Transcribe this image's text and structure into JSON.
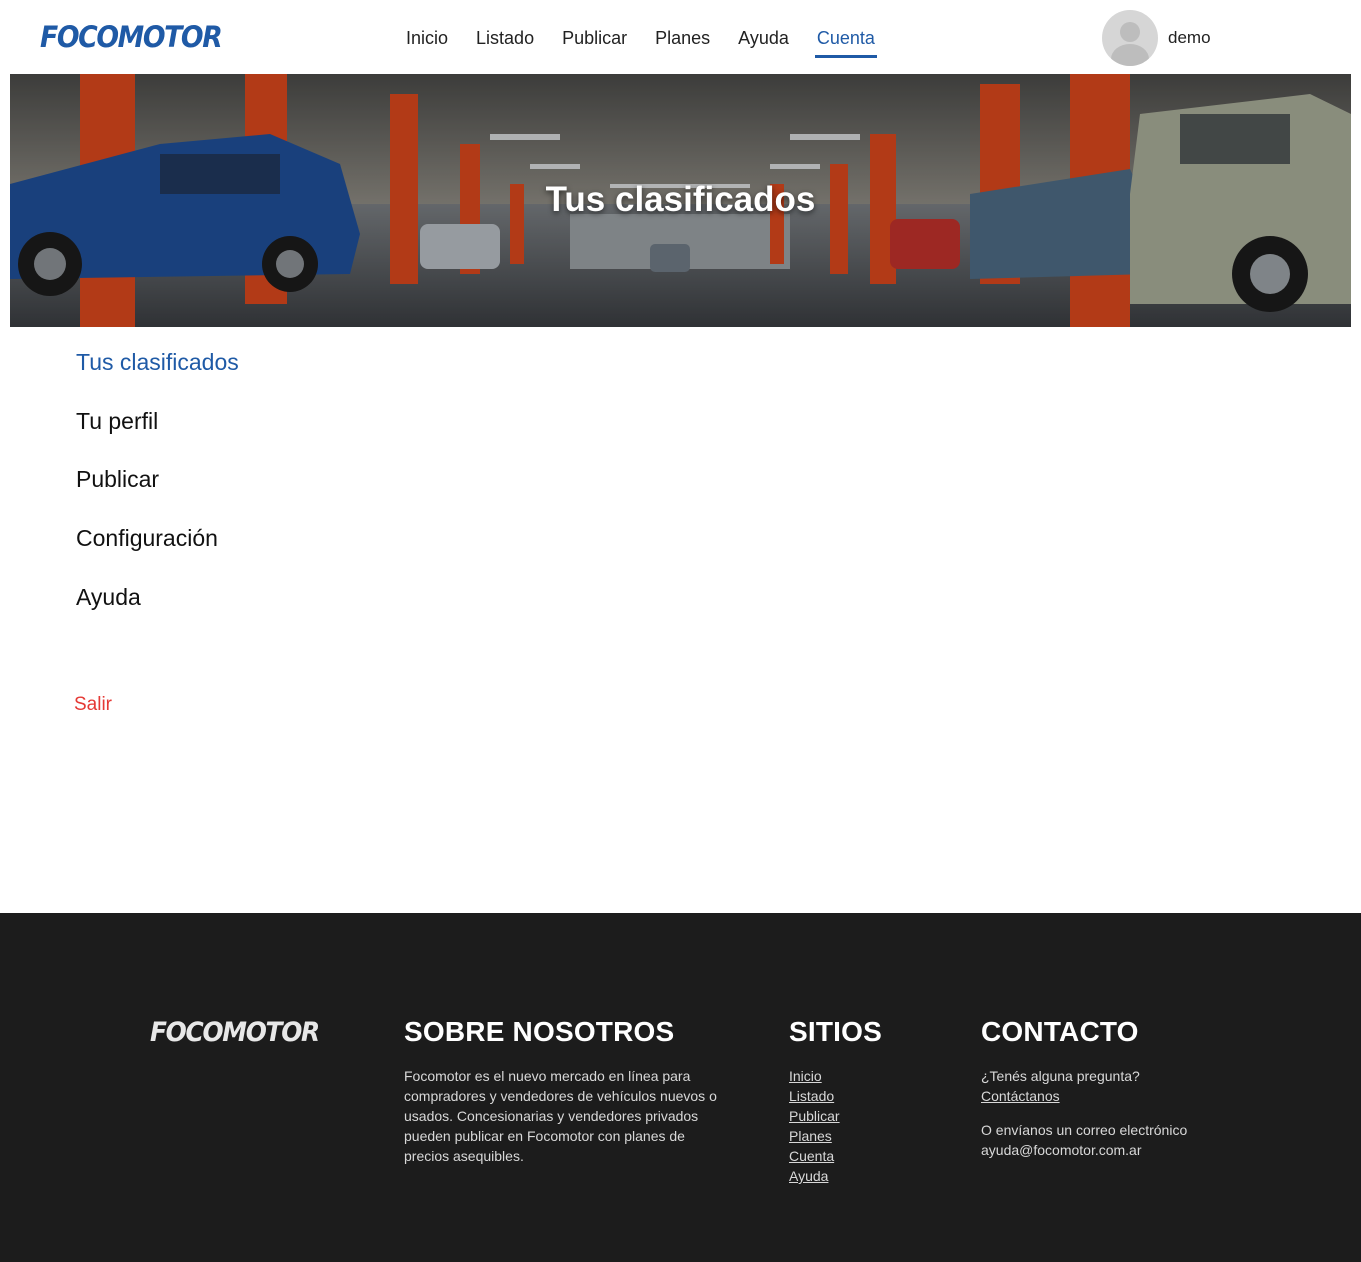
{
  "header": {
    "logo": "FOCOMOTOR",
    "nav": [
      {
        "label": "Inicio",
        "active": false
      },
      {
        "label": "Listado",
        "active": false
      },
      {
        "label": "Publicar",
        "active": false
      },
      {
        "label": "Planes",
        "active": false
      },
      {
        "label": "Ayuda",
        "active": false
      },
      {
        "label": "Cuenta",
        "active": true
      }
    ],
    "username": "demo"
  },
  "hero": {
    "title": "Tus clasificados"
  },
  "menu": {
    "items": [
      {
        "label": "Tus clasificados",
        "active": true
      },
      {
        "label": "Tu perfil",
        "active": false
      },
      {
        "label": "Publicar",
        "active": false
      },
      {
        "label": "Configuración",
        "active": false
      },
      {
        "label": "Ayuda",
        "active": false
      }
    ],
    "logout": "Salir"
  },
  "footer": {
    "logo": "FOCOMOTOR",
    "about": {
      "title": "SOBRE NOSOTROS",
      "text": "Focomotor es el nuevo mercado en línea para compradores y vendedores de vehículos nuevos o usados. Concesionarias y vendedores privados pueden publicar en Focomotor con planes de precios asequibles."
    },
    "sites": {
      "title": "SITIOS",
      "links": [
        "Inicio",
        "Listado",
        "Publicar",
        "Planes",
        "Cuenta",
        "Ayuda"
      ]
    },
    "contact": {
      "title": "CONTACTO",
      "question": "¿Tenés alguna pregunta?",
      "link": "Contáctanos",
      "email_text": "O envíanos un correo electrónico",
      "email": "ayuda@focomotor.com.ar"
    }
  },
  "colors": {
    "brand_blue": "#1f5aa6",
    "logout_red": "#e53935",
    "footer_bg": "#1c1c1c"
  }
}
